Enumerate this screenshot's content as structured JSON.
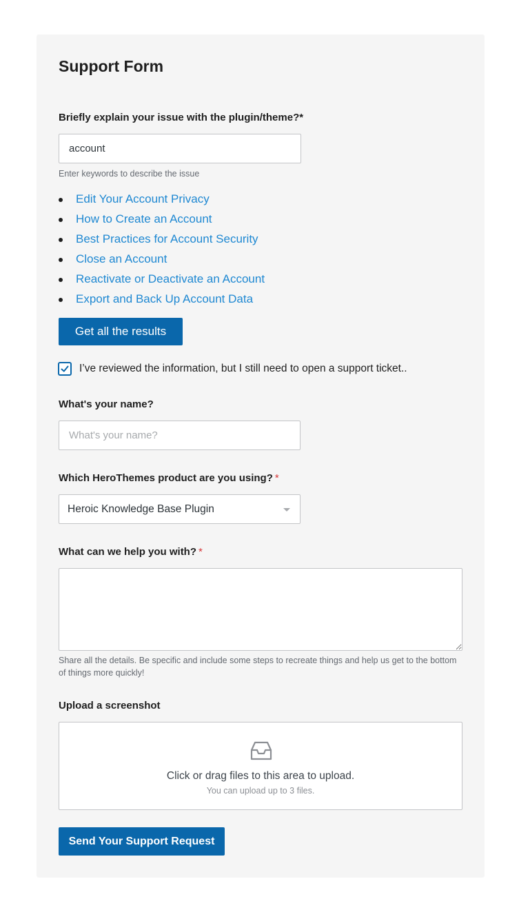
{
  "form": {
    "title": "Support Form",
    "issue": {
      "label": "Briefly explain your issue with the plugin/theme?*",
      "value": "account",
      "help": "Enter keywords to describe the issue"
    },
    "results": [
      "Edit Your Account Privacy",
      "How to Create an Account",
      "Best Practices for Account Security",
      "Close an Account",
      "Reactivate or Deactivate an Account",
      "Export and Back Up Account Data"
    ],
    "get_results_label": "Get all the results",
    "reviewed": {
      "checked": true,
      "label": "I’ve reviewed the information, but I still need to open a support ticket.."
    },
    "name": {
      "label": "What's your name?",
      "placeholder": "What's your name?"
    },
    "product": {
      "label": "Which HeroThemes product are you using?",
      "required_mark": "*",
      "selected": "Heroic Knowledge Base Plugin"
    },
    "help_with": {
      "label": "What can we help you with?",
      "required_mark": "*",
      "value": "",
      "help": "Share all the details. Be specific and include some steps to recreate things and help us get to the bottom of things more quickly!"
    },
    "upload": {
      "label": "Upload a screenshot",
      "main_text": "Click or drag files to this area to upload.",
      "sub_text": "You can upload up to 3 files.",
      "icon": "inbox-icon"
    },
    "submit_label": "Send Your Support Request"
  },
  "colors": {
    "accent": "#0a67ab",
    "link": "#1e88d2",
    "required": "#d63638",
    "panel_bg": "#f5f5f5"
  }
}
